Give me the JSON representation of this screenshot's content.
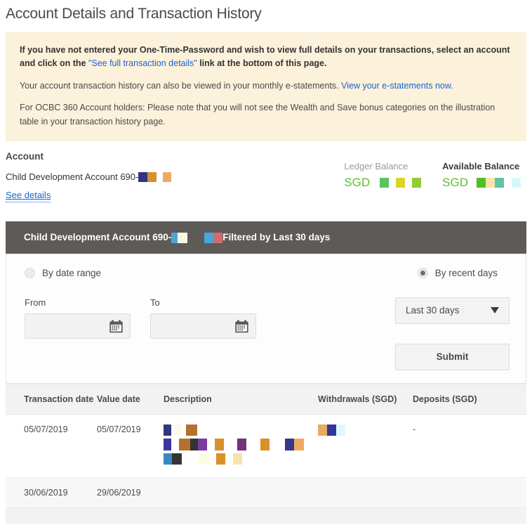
{
  "page": {
    "title": "Account Details and Transaction History"
  },
  "notice": {
    "line1_part1": "If you have not entered your One-Time-Password and wish to view full details on your transactions, select an account and click on the ",
    "line1_link": "\"See full transaction details\"",
    "line1_part2": " link at the bottom of this page.",
    "line2_part1": "Your account transaction history can also be viewed in your monthly e-statements. ",
    "line2_link": "View your e-statements now.",
    "line3": "For OCBC 360 Account holders: Please note that you will not see the Wealth and Save bonus categories on the illustration table in your transaction history page."
  },
  "account": {
    "section_label": "Account",
    "name": "Child Development Account 690-",
    "see_details_label": "See details",
    "name_redactions": [
      {
        "color": "#33357f",
        "width": 13
      },
      {
        "color": "#d4912f",
        "width": 13
      },
      {
        "color": "#ffffff",
        "width": 9
      },
      {
        "color": "#eeab60",
        "width": 12
      }
    ],
    "ledger_balance": {
      "label": "Ledger Balance",
      "currency": "SGD",
      "redactions": [
        {
          "color": "#ffffff",
          "width": 8
        },
        {
          "color": "#5cc45f",
          "width": 13
        },
        {
          "color": "#ffffff",
          "width": 10
        },
        {
          "color": "#dad427",
          "width": 13
        },
        {
          "color": "#ffffff",
          "width": 10
        },
        {
          "color": "#95cb35",
          "width": 13
        }
      ]
    },
    "available_balance": {
      "label": "Available Balance",
      "currency": "SGD",
      "redactions": [
        {
          "color": "#ffffff",
          "width": 6
        },
        {
          "color": "#54be22",
          "width": 13
        },
        {
          "color": "#f7e4a8",
          "width": 13
        },
        {
          "color": "#61c3a4",
          "width": 13
        },
        {
          "color": "#ffffff",
          "width": 11
        },
        {
          "color": "#d6f8f9",
          "width": 13
        }
      ]
    }
  },
  "panel": {
    "header_account": "Child Development Account 690-",
    "header_account_redactions": [
      {
        "color": "#4ba6d8",
        "width": 9
      },
      {
        "color": "#f9f6e0",
        "width": 14
      }
    ],
    "header_gap_redactions": [
      {
        "color": "#4ba6d8",
        "width": 13
      },
      {
        "color": "#cf6d6d",
        "width": 13
      }
    ],
    "header_filter": "Filtered by Last 30 days",
    "radio_date_range": "By date range",
    "radio_recent_days": "By recent days",
    "selected_radio": "recent_days",
    "from_label": "From",
    "to_label": "To",
    "from_value": "",
    "to_value": "",
    "recent_days_selected": "Last 30 days",
    "recent_days_options": [
      "Last 30 days"
    ],
    "submit_label": "Submit"
  },
  "table": {
    "columns": [
      "Transaction date",
      "Value date",
      "Description",
      "Withdrawals (SGD)",
      "Deposits (SGD)"
    ],
    "rows": [
      {
        "transaction_date": "05/07/2019",
        "value_date": "05/07/2019",
        "description_redactions": [
          [
            {
              "color": "#33357f",
              "width": 11,
              "height": 16,
              "gap": 0
            },
            {
              "color": "#fdfbe8",
              "width": 12,
              "height": 16,
              "gap": 3
            },
            {
              "color": "#b5702e",
              "width": 16,
              "height": 16,
              "gap": 6
            }
          ],
          [
            {
              "color": "#3b35a0",
              "width": 11,
              "height": 17,
              "gap": 0
            },
            {
              "color": "#b5702e",
              "width": 16,
              "height": 17,
              "gap": 11
            },
            {
              "color": "#343434",
              "width": 11,
              "height": 17,
              "gap": 0
            },
            {
              "color": "#7b3ba0",
              "width": 13,
              "height": 17,
              "gap": 0
            },
            {
              "color": "#d8912b",
              "width": 13,
              "height": 17,
              "gap": 11
            },
            {
              "color": "#75307e",
              "width": 13,
              "height": 17,
              "gap": 19
            },
            {
              "color": "#d8912b",
              "width": 13,
              "height": 17,
              "gap": 20
            },
            {
              "color": "#343a87",
              "width": 13,
              "height": 17,
              "gap": 22
            },
            {
              "color": "#eeab60",
              "width": 14,
              "height": 17,
              "gap": 0
            }
          ],
          [
            {
              "color": "#3b86c4",
              "width": 12,
              "height": 16,
              "gap": 0
            },
            {
              "color": "#343434",
              "width": 14,
              "height": 16,
              "gap": 0
            },
            {
              "color": "#fdfbe0",
              "width": 14,
              "height": 16,
              "gap": 25
            },
            {
              "color": "#d8912b",
              "width": 13,
              "height": 16,
              "gap": 10
            },
            {
              "color": "#f9e2ab",
              "width": 13,
              "height": 16,
              "gap": 11
            }
          ]
        ],
        "withdrawals_redactions": [
          {
            "color": "#e8ab63",
            "width": 13,
            "height": 16
          },
          {
            "color": "#35359a",
            "width": 13,
            "height": 16
          },
          {
            "color": "#ddf8fc",
            "width": 13,
            "height": 16
          }
        ],
        "deposits": "-"
      },
      {
        "transaction_date": "30/06/2019",
        "value_date": "29/06/2019",
        "description_redactions": [],
        "withdrawals_redactions": [],
        "deposits": ""
      }
    ]
  }
}
